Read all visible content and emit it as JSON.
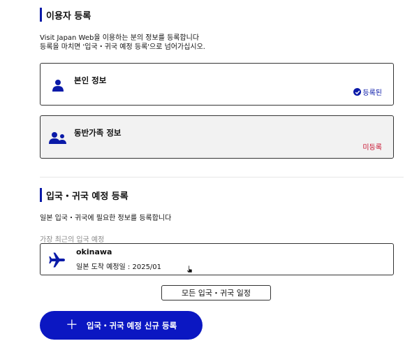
{
  "user_registration": {
    "title": "이용자 등록",
    "desc_line1": "Visit Japan Web을 이용하는 분의 정보를 등록합니다",
    "desc_line2": "등록을 마치면 '입국・귀국 예정 등록'으로 넘어가십시오."
  },
  "self_info": {
    "title": "본인 정보",
    "status": "등록된",
    "status_color": "#0a1aa8"
  },
  "companion_info": {
    "title": "동반가족 정보",
    "status": "미등록",
    "status_color": "#c8102e"
  },
  "trip_registration": {
    "title": "입국・귀국 예정 등록",
    "desc": "일본 입국・귀국에 필요한 정보를 등록합니다",
    "latest_label": "가장 최근의 입국 예정",
    "latest_trip": {
      "destination": "okinawa",
      "arrival": "일본 도착 예정일 : 2025/01"
    },
    "all_button_label": "모든 입국・귀국 일정",
    "new_button_label": "입국・귀국 예정 신규 등록"
  },
  "icons": {
    "person": "person-icon",
    "people": "people-icon",
    "check": "check-circle-icon",
    "plane": "airplane-icon",
    "plus": "plus-icon"
  },
  "colors": {
    "accent": "#0b17c2",
    "registered": "#0a1aa8",
    "unregistered": "#c8102e"
  }
}
